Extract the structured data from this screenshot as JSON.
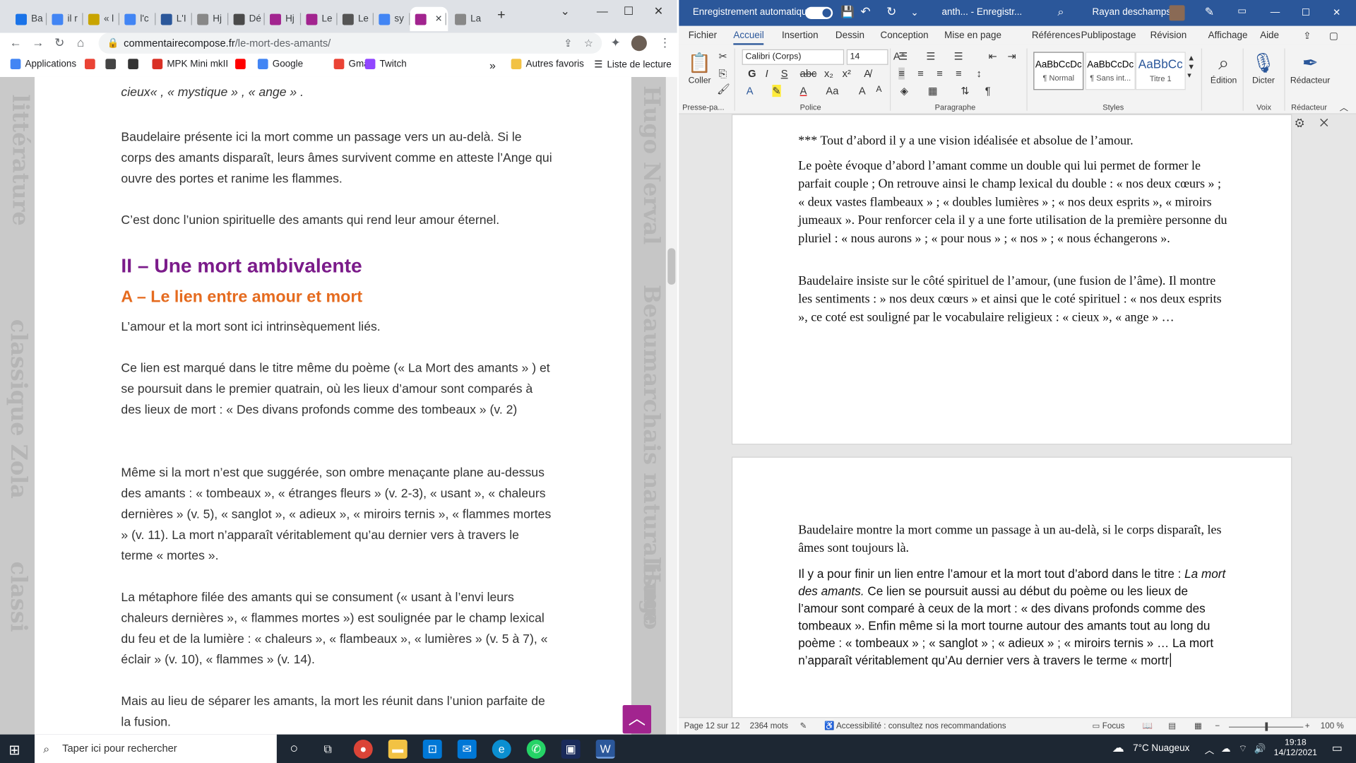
{
  "chrome": {
    "tabs": [
      {
        "label": "Ba",
        "color": "#1a73e8"
      },
      {
        "label": "il r",
        "color": "#4285f4"
      },
      {
        "label": "« l",
        "color": "#c8a400"
      },
      {
        "label": "l'c",
        "color": "#4285f4"
      },
      {
        "label": "L'I",
        "color": "#2b579a"
      },
      {
        "label": "Hj",
        "color": "#888888"
      },
      {
        "label": "Dé",
        "color": "#4a4a4a"
      },
      {
        "label": "Hj",
        "color": "#a2248f"
      },
      {
        "label": "Le",
        "color": "#a2248f"
      },
      {
        "label": "Le",
        "color": "#555555"
      },
      {
        "label": "sy",
        "color": "#4285f4"
      },
      {
        "label": "",
        "color": "#a2248f"
      },
      {
        "label": "La",
        "color": "#888888"
      }
    ],
    "new_tab": "+",
    "url_domain": "commentairecompose.fr",
    "url_path": "/le-mort-des-amants/",
    "bookmarks": [
      {
        "label": "Applications",
        "color": "#4285f4"
      },
      {
        "label": "",
        "color": "#ea4335"
      },
      {
        "label": "",
        "color": "#444444"
      },
      {
        "label": "",
        "color": "#333333"
      },
      {
        "label": "MPK Mini mkII",
        "color": "#d93025"
      },
      {
        "label": "",
        "color": "#ff0000"
      },
      {
        "label": "Google",
        "color": "#4285f4"
      },
      {
        "label": "Gmail",
        "color": "#ea4335"
      },
      {
        "label": "Twitch",
        "color": "#9146ff"
      }
    ],
    "bookmarks_more": "»",
    "other_favorites": "Autres favoris",
    "reading_list": "Liste de lecture",
    "article": {
      "line0": "cieux« , « mystique » , « ange » .",
      "p1": "Baudelaire présente ici la mort comme un passage vers un au-delà. Si le corps des amants disparaît, leurs âmes survivent comme en atteste l’Ange qui ouvre des portes et ranime les flammes.",
      "p2": "C’est donc l’union spirituelle des amants qui rend leur amour éternel.",
      "h2": "II – Une mort ambivalente",
      "h3": "A – Le lien entre amour et mort",
      "p3": "L’amour et la mort sont ici intrinsèquement liés.",
      "p4": "Ce lien est marqué dans le titre même du poème (« La Mort des amants » ) et se poursuit dans le premier quatrain, où les lieux d’amour sont comparés à des lieux de mort : « Des divans profonds comme des tombeaux » (v. 2)",
      "p5": "Même si la mort n’est que suggérée, son ombre menaçante plane au-dessus des amants : « tombeaux », « étranges fleurs » (v. 2-3), « usant », « chaleurs dernières » (v. 5), « sanglot », « adieux », « miroirs ternis », « flammes mortes » (v. 11). La mort n’apparaît véritablement qu’au dernier vers à travers le terme « mortes ».",
      "p6": "La métaphore filée des amants qui se consument (« usant à l’envi leurs chaleurs dernières », « flammes mortes ») est soulignée par le champ lexical du feu et de la lumière : « chaleurs », « flambeaux », « lumières » (v. 5 à 7), « éclair » (v. 10), « flammes » (v. 14).",
      "p7": "Mais au lieu de séparer les amants, la mort les réunit dans l’union parfaite de la fusion.",
      "back_to_top": "︿"
    }
  },
  "word": {
    "autosave": "Enregistrement automatique",
    "doc_title": "anth...  -  Enregistr...",
    "user": "Rayan deschamps",
    "menus": [
      "Fichier",
      "Accueil",
      "Insertion",
      "Dessin",
      "Conception",
      "Mise en page",
      "Références",
      "Publipostage",
      "Révision",
      "Affichage",
      "Aide"
    ],
    "font_name": "Calibri (Corps)",
    "font_size": "14",
    "paste": "Coller",
    "styles": [
      {
        "preview": "AaBbCcDc",
        "name": "¶ Normal"
      },
      {
        "preview": "AaBbCcDc",
        "name": "¶ Sans int..."
      },
      {
        "preview": "AaBbCc",
        "name": "Titre 1"
      }
    ],
    "edit": "Édition",
    "dictate": "Dicter",
    "editor": "Rédacteur",
    "groups": [
      "Presse-pa...",
      "Police",
      "Paragraphe",
      "Styles",
      "Voix",
      "Rédacteur"
    ],
    "page1": {
      "l1": "*** Tout d’abord il y a une vision idéalisée et absolue de l’amour.",
      "l2": "Le poète évoque d’abord l’amant comme un double qui lui permet de former le parfait couple ; On retrouve ainsi le champ lexical du double : « nos deux cœurs » ; « deux vastes flambeaux » ; « doubles lumières » ; « nos deux esprits », « miroirs jumeaux ». Pour renforcer cela il y a une forte utilisation de la première personne du pluriel : « nous aurons » ; « pour nous » ; « nos » ; « nous échangerons ».",
      "l3": "Baudelaire insiste sur le côté spirituel de l’amour, (une fusion de l’âme). Il montre les sentiments : » nos deux cœurs » et ainsi que le coté spirituel : « nos deux esprits », ce coté est souligné par le vocabulaire religieux : « cieux », « ange » …"
    },
    "page2": {
      "l1": "Baudelaire montre la mort comme un passage à un au-delà, si le corps disparaît, les âmes sont toujours là.",
      "l2a": "  Il y a pour finir un lien entre l’amour et la mort tout d’abord dans le titre : ",
      "l2i": "La mort des amants.",
      "l2b": " Ce lien se poursuit aussi au début du poème ou les lieux de l’amour sont comparé à ceux de la mort : « des divans profonds comme des tombeaux ». Enfin même si la mort tourne autour des amants tout au long du poème : « tombeaux » ; « sanglot » ; « adieux » ; « miroirs ternis » … La mort n’apparaît véritablement qu’Au dernier vers à travers le terme « mortr"
    },
    "status": {
      "page": "Page 12 sur 12",
      "words": "2364 mots",
      "access": "Accessibilité : consultez nos recommandations",
      "focus": "Focus",
      "zoom": "100 %"
    }
  },
  "taskbar": {
    "search_placeholder": "Taper ici pour rechercher",
    "weather": "7°C  Nuageux",
    "time": "19:18",
    "date": "14/12/2021"
  }
}
